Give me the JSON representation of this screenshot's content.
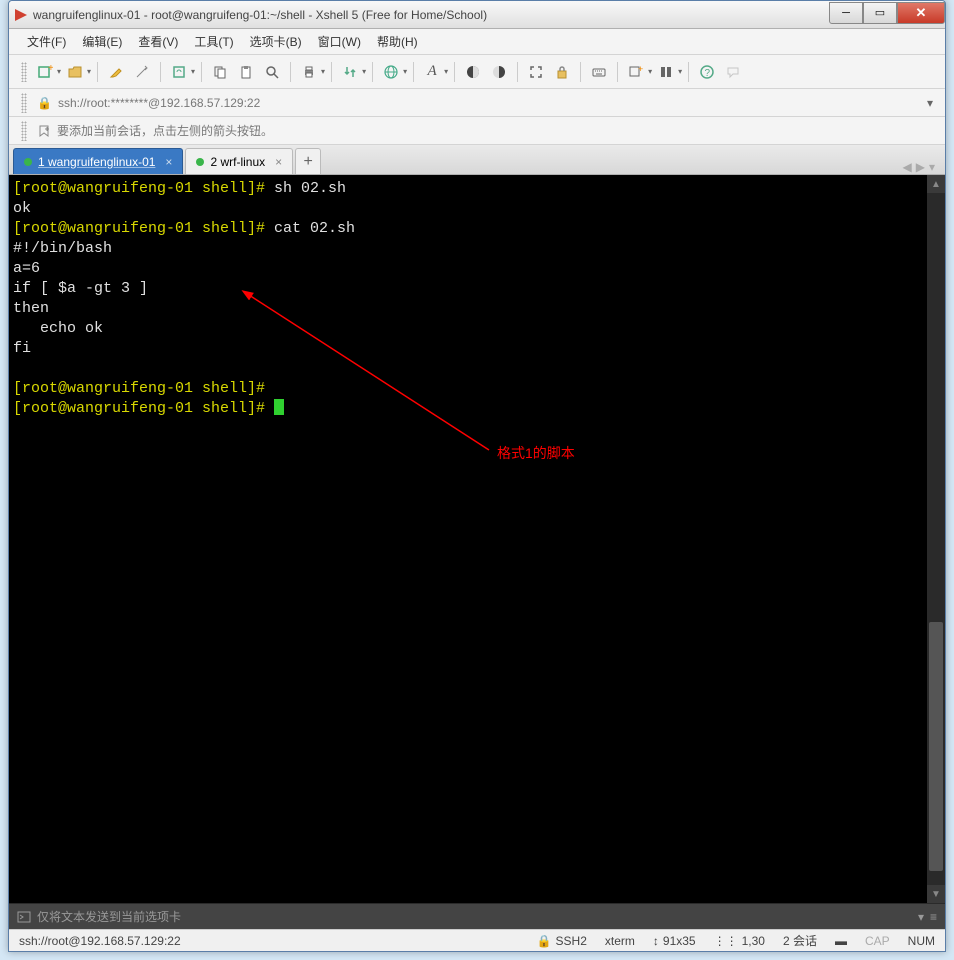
{
  "window": {
    "title": "wangruifenglinux-01 - root@wangruifeng-01:~/shell - Xshell 5 (Free for Home/School)"
  },
  "menu": {
    "items": [
      "文件(F)",
      "编辑(E)",
      "查看(V)",
      "工具(T)",
      "选项卡(B)",
      "窗口(W)",
      "帮助(H)"
    ]
  },
  "address": {
    "text": "ssh://root:********@192.168.57.129:22"
  },
  "hint": {
    "text": "要添加当前会话，点击左侧的箭头按钮。"
  },
  "tabs": {
    "items": [
      {
        "label": "1 wangruifenglinux-01",
        "active": true,
        "dot": "green"
      },
      {
        "label": "2 wrf-linux",
        "active": false,
        "dot": "green"
      }
    ]
  },
  "terminal": {
    "lines": [
      {
        "prompt": "[root@wangruifeng-01 shell]# ",
        "cmd": "sh 02.sh"
      },
      {
        "out": "ok"
      },
      {
        "prompt": "[root@wangruifeng-01 shell]# ",
        "cmd": "cat 02.sh"
      },
      {
        "out": "#!/bin/bash"
      },
      {
        "out": "a=6"
      },
      {
        "out": "if [ $a -gt 3 ]"
      },
      {
        "out": "then"
      },
      {
        "out": "   echo ok"
      },
      {
        "out": "fi"
      },
      {
        "out": ""
      },
      {
        "prompt": "[root@wangruifeng-01 shell]# ",
        "cmd": ""
      },
      {
        "prompt": "[root@wangruifeng-01 shell]# ",
        "cmd": "",
        "cursor": true
      }
    ]
  },
  "annotation": {
    "text": "格式1的脚本"
  },
  "inputbar": {
    "text": "仅将文本发送到当前选项卡"
  },
  "status": {
    "left": "ssh://root@192.168.57.129:22",
    "ssh": "SSH2",
    "term": "xterm",
    "size": "91x35",
    "pos": "1,30",
    "sessions": "2 会话",
    "cap": "CAP",
    "num": "NUM"
  },
  "icons": {
    "new": "＋",
    "open": "📁",
    "edit": "✎",
    "wand": "✨",
    "reconnect": "⟳",
    "copy": "⎘",
    "paste": "📋",
    "search": "🔍",
    "print": "🖶",
    "transfer": "⇅",
    "globe": "🌐",
    "font": "A",
    "props": "☰",
    "script1": "◑",
    "script2": "◐",
    "fullscreen": "⛶",
    "lock": "🔒",
    "keyboard": "⌨",
    "layout": "▦",
    "view": "▮▮",
    "help": "?",
    "chat": "💬"
  }
}
